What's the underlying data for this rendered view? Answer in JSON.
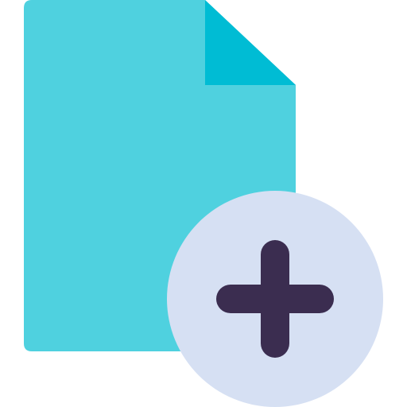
{
  "icon": {
    "name": "add-file-icon",
    "colors": {
      "document": "#4fd1df",
      "fold": "#00bcd4",
      "badge": "#d6e0f3",
      "plus": "#3b2d50",
      "background": "#ffffff"
    }
  }
}
